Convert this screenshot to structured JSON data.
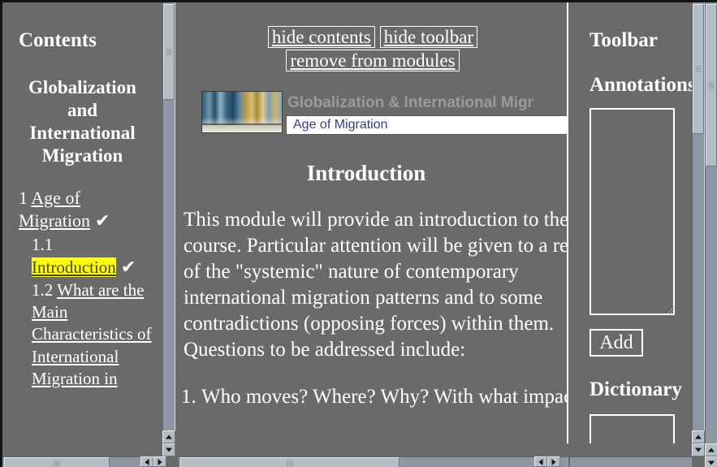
{
  "contents": {
    "heading": "Contents",
    "course_title": "Globalization and International Migration",
    "toc": [
      {
        "number": "1",
        "label": "Age of Migration",
        "check": "✔",
        "level": 1,
        "current": false
      },
      {
        "number": "1.1",
        "label": "Introduction",
        "check": "✔",
        "level": 2,
        "current": true
      },
      {
        "number": "1.2",
        "label": "What are the Main Characteristics of International Migration in",
        "check": "",
        "level": 2,
        "current": false
      }
    ]
  },
  "content": {
    "toolbar_links": [
      "hide contents",
      "hide toolbar",
      "remove from modules"
    ],
    "banner": {
      "title": "Globalization & International Migr",
      "subtitle": "Age of Migration",
      "photo_alt": "cityscape-photo"
    },
    "heading": "Introduction",
    "body": "This module will provide an introduction to the course. Particular attention will be given to a review of the \"systemic\" nature of contemporary international migration patterns and to some contradictions (opposing forces) within them. Questions to be addressed include:",
    "list": [
      "Who moves? Where? Why? With what impact?"
    ]
  },
  "toolbar": {
    "heading": "Toolbar",
    "annotation_heading": "Annotations",
    "annotation_value": "",
    "add_label": "Add",
    "dictionary_heading": "Dictionary",
    "dictionary_value": ""
  },
  "colors": {
    "page_background": "#6a6a6a",
    "text": "#ffffff",
    "highlight": "#ffff00",
    "highlight_text": "#4a4a20",
    "scrollbar_track": "#8e97a3",
    "scrollbar_thumb": "#b4bcc6",
    "banner_subtitle_text": "#3b3b8f",
    "banner_title_text": "#9b9b9b"
  }
}
